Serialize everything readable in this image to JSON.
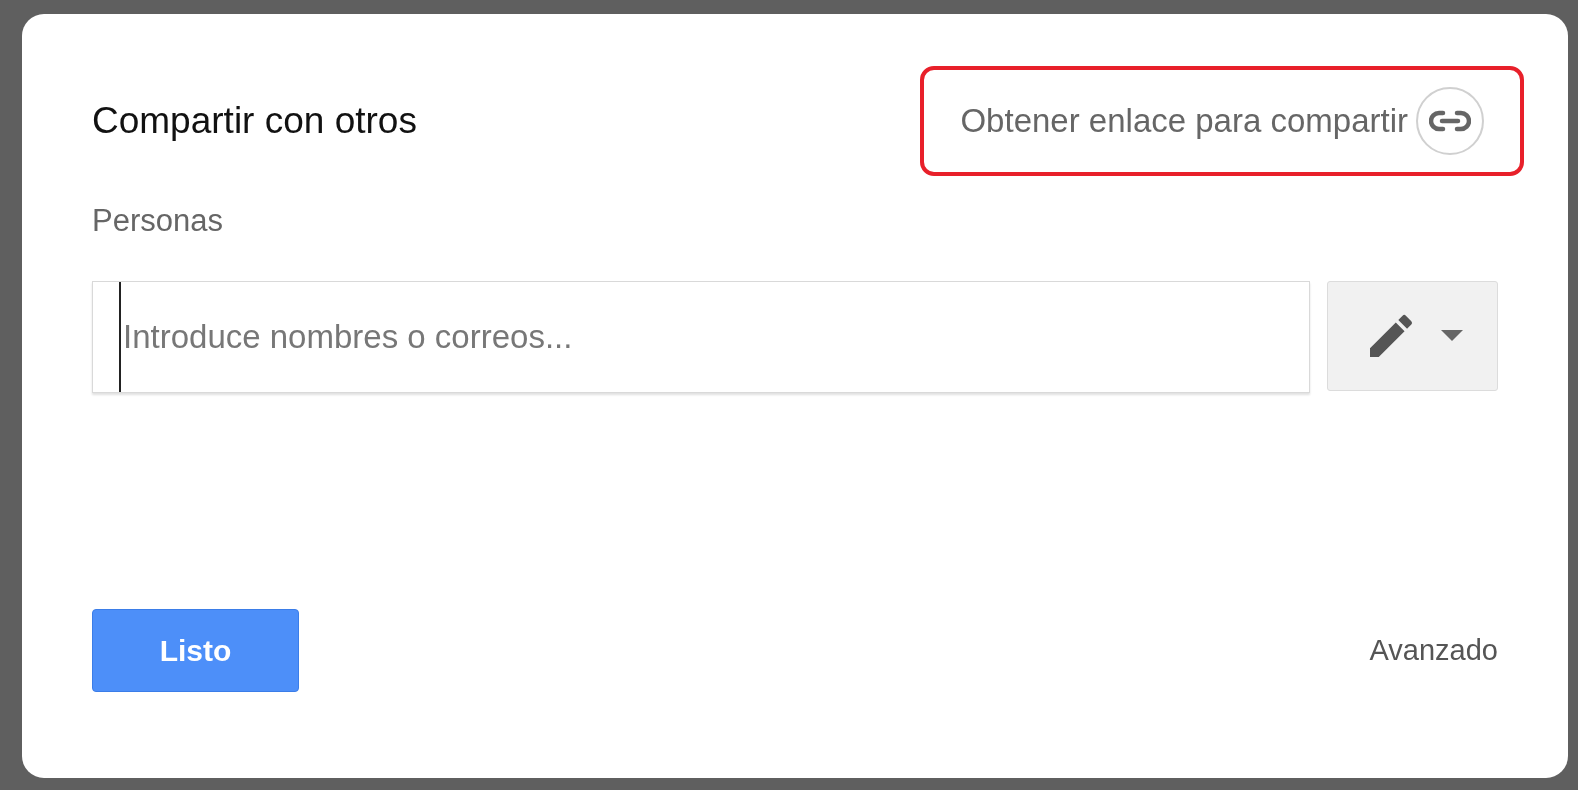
{
  "dialog": {
    "title": "Compartir con otros",
    "link_button": {
      "label": "Obtener enlace para compartir",
      "highlighted": true
    },
    "people_label": "Personas",
    "people_field": {
      "placeholder": "Introduce nombres o correos..."
    },
    "done_button": "Listo",
    "advanced_link": "Avanzado"
  }
}
